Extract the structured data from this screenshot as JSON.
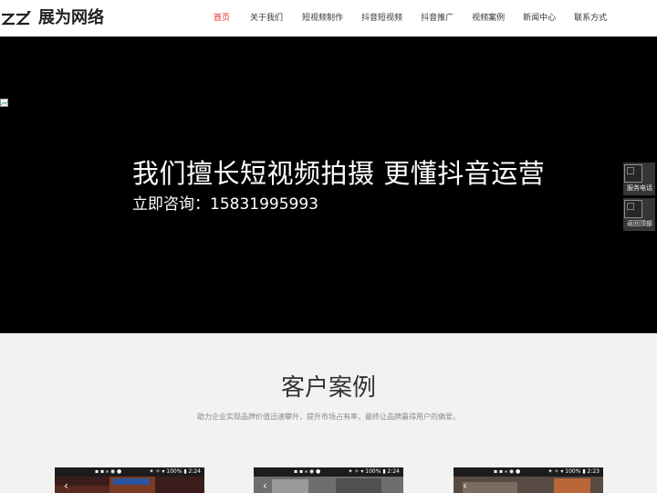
{
  "header": {
    "logo_text": "展为网络",
    "nav": [
      {
        "label": "首页",
        "active": true
      },
      {
        "label": "关于我们",
        "active": false
      },
      {
        "label": "短视频制作",
        "active": false
      },
      {
        "label": "抖音短视频",
        "active": false
      },
      {
        "label": "抖音推广",
        "active": false
      },
      {
        "label": "视频案例",
        "active": false
      },
      {
        "label": "新闻中心",
        "active": false
      },
      {
        "label": "联系方式",
        "active": false
      }
    ]
  },
  "banner": {
    "title": "我们擅长短视频拍摄 更懂抖音运营",
    "subtitle": "立即咨询：15831995993"
  },
  "float": {
    "phone_label": "服务电话",
    "top_label": "返回顶部"
  },
  "cases": {
    "title": "客户案例",
    "description": "助力企业实现品牌价值迅速攀升，提升市场占有率，最终让品牌赢得用户的偏爱。",
    "items": [
      {
        "status_left": "▪ ▪ ⁎ ◉ ●",
        "status_right": "✦ ✧ ▾ 100% ▮ 2:24"
      },
      {
        "status_left": "▪ ▪ ⁎ ◉ ●",
        "status_right": "✦ ✧ ▾ 100% ▮ 2:24"
      },
      {
        "status_left": "▪ ▪ ⁎ ◉ ●",
        "status_right": "✦ ✧ ▾ 100% ▮ 2:23"
      }
    ]
  },
  "colors": {
    "accent": "#e32a2a",
    "banner_bg": "#000000",
    "section_bg": "#f2f2f2"
  }
}
